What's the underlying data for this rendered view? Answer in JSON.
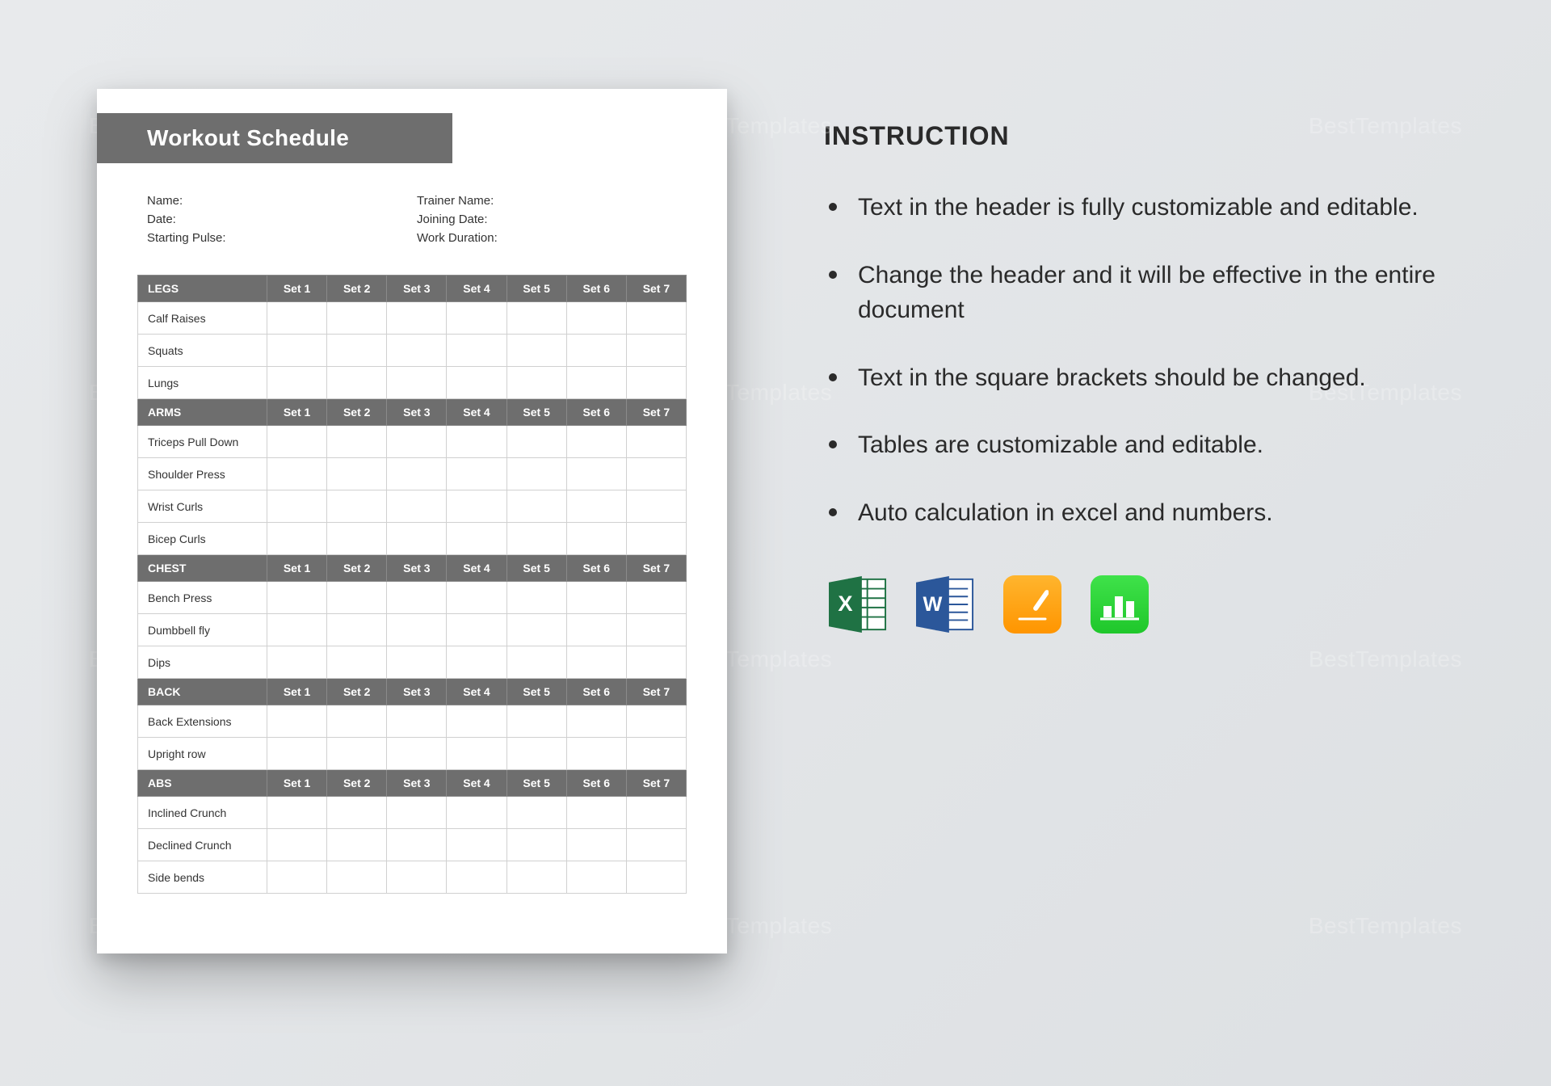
{
  "watermark": "BestTemplates",
  "document": {
    "title": "Workout Schedule",
    "meta": {
      "name_label": "Name:",
      "date_label": "Date:",
      "starting_pulse_label": "Starting Pulse:",
      "trainer_name_label": "Trainer Name:",
      "joining_date_label": "Joining Date:",
      "work_duration_label": "Work Duration:"
    },
    "set_headers": [
      "Set 1",
      "Set 2",
      "Set 3",
      "Set 4",
      "Set 5",
      "Set 6",
      "Set 7"
    ],
    "sections": [
      {
        "group": "LEGS",
        "exercises": [
          "Calf Raises",
          "Squats",
          "Lungs"
        ]
      },
      {
        "group": "ARMS",
        "exercises": [
          "Triceps Pull Down",
          "Shoulder Press",
          "Wrist Curls",
          "Bicep Curls"
        ]
      },
      {
        "group": "CHEST",
        "exercises": [
          "Bench Press",
          "Dumbbell fly",
          "Dips"
        ]
      },
      {
        "group": "BACK",
        "exercises": [
          "Back Extensions",
          "Upright row"
        ]
      },
      {
        "group": "ABS",
        "exercises": [
          "Inclined Crunch",
          "Declined Crunch",
          "Side bends"
        ]
      }
    ]
  },
  "instructions": {
    "heading": "INSTRUCTION",
    "items": [
      "Text in the header is fully customizable and editable.",
      "Change the header and it will be effective in the entire document",
      "Text in the square brackets should be changed.",
      "Tables are customizable and editable.",
      "Auto calculation in excel and numbers."
    ]
  },
  "apps": {
    "excel": "Excel",
    "word": "Word",
    "pages": "Pages",
    "numbers": "Numbers"
  }
}
